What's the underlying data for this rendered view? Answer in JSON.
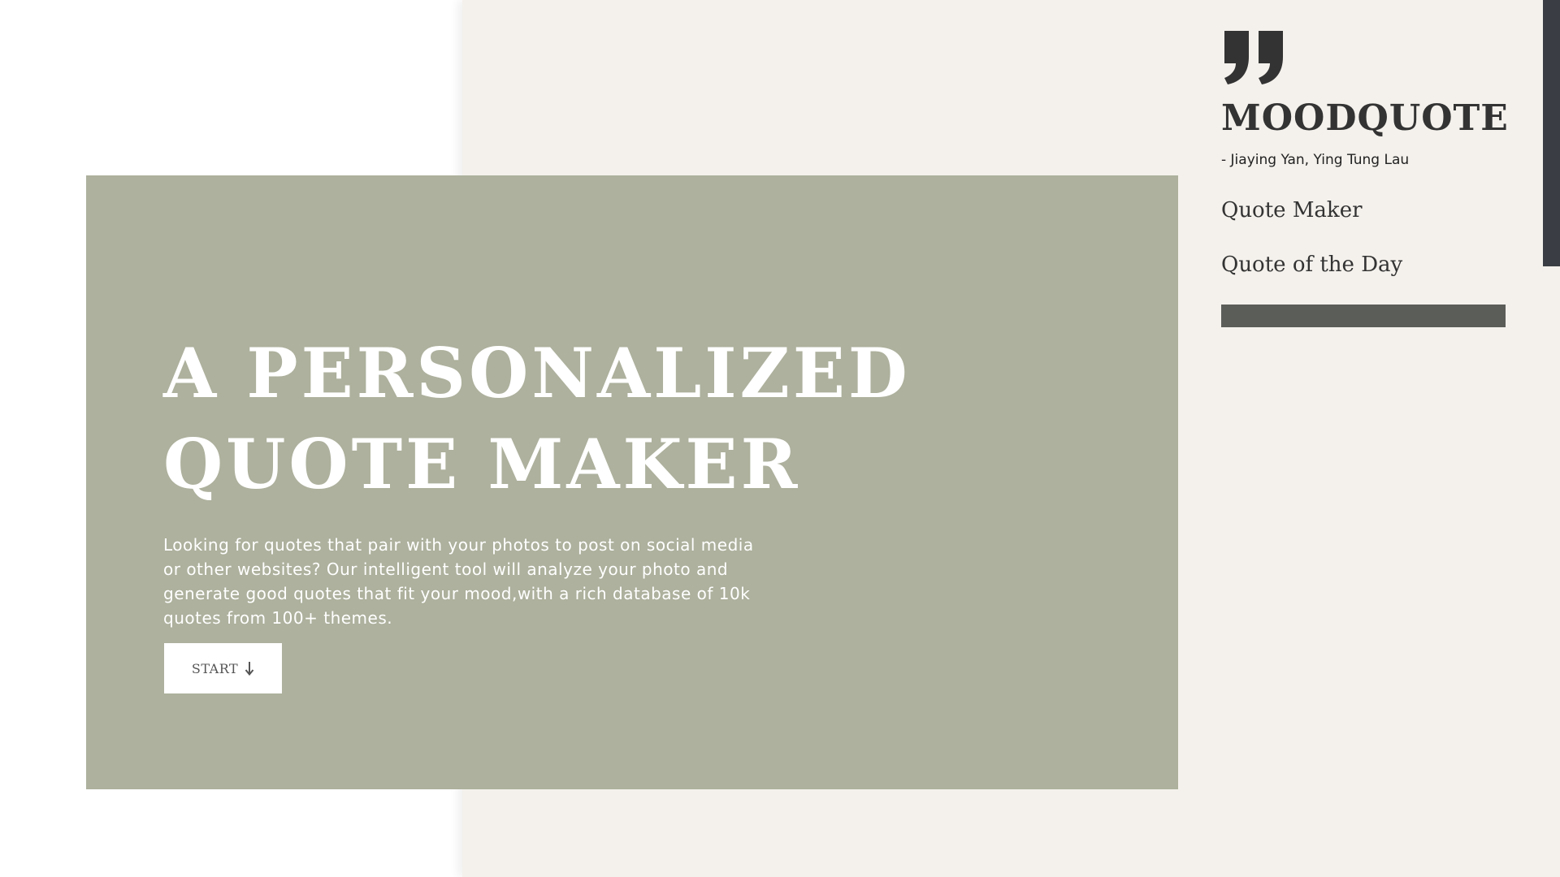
{
  "hero": {
    "title_line1": "A PERSONALIZED",
    "title_line2": "QUOTE MAKER",
    "description": "Looking for quotes that pair with your photos to post on social media or other websites? Our intelligent tool will analyze your photo and generate good quotes that fit your mood,with a rich database of 10k quotes from 100+ themes.",
    "start_label": "START",
    "start_icon": "arrow-down-icon"
  },
  "sidebar": {
    "logo_icon": "quote-mark-icon",
    "brand": "MOODQUOTE",
    "authors": "- Jiaying Yan, Ying Tung Lau",
    "nav": [
      {
        "label": "Quote Maker"
      },
      {
        "label": "Quote of the Day"
      }
    ]
  },
  "colors": {
    "hero_background": "#adb19d",
    "panel_background": "#f4f1ec",
    "sidebar_bar": "#5b5d59",
    "scrollbar_thumb": "#3a3d44",
    "text_dark": "#333333"
  }
}
